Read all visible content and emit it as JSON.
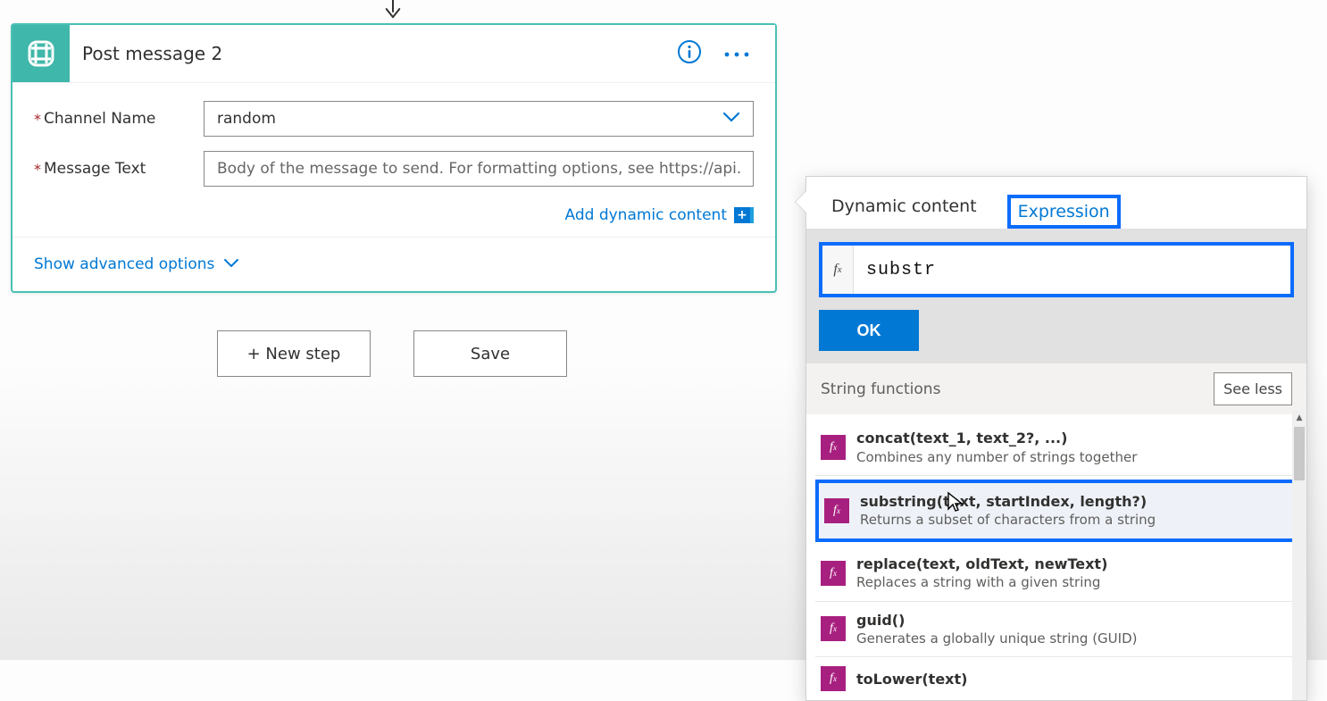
{
  "card": {
    "title": "Post message 2",
    "fields": {
      "channel_label": "Channel Name",
      "channel_value": "random",
      "message_label": "Message Text",
      "message_placeholder": "Body of the message to send. For formatting options, see https://api.slack.com."
    },
    "add_dynamic": "Add dynamic content",
    "advanced": "Show advanced options"
  },
  "buttons": {
    "new_step": "+ New step",
    "save": "Save"
  },
  "flyout": {
    "tabs": {
      "dynamic": "Dynamic content",
      "expression": "Expression"
    },
    "formula": "substr",
    "ok": "OK",
    "section": {
      "title": "String functions",
      "toggle": "See less"
    },
    "functions": [
      {
        "sig": "concat(text_1, text_2?, ...)",
        "desc": "Combines any number of strings together"
      },
      {
        "sig": "substring(text, startIndex, length?)",
        "desc": "Returns a subset of characters from a string"
      },
      {
        "sig": "replace(text, oldText, newText)",
        "desc": "Replaces a string with a given string"
      },
      {
        "sig": "guid()",
        "desc": "Generates a globally unique string (GUID)"
      },
      {
        "sig": "toLower(text)",
        "desc": ""
      }
    ]
  }
}
